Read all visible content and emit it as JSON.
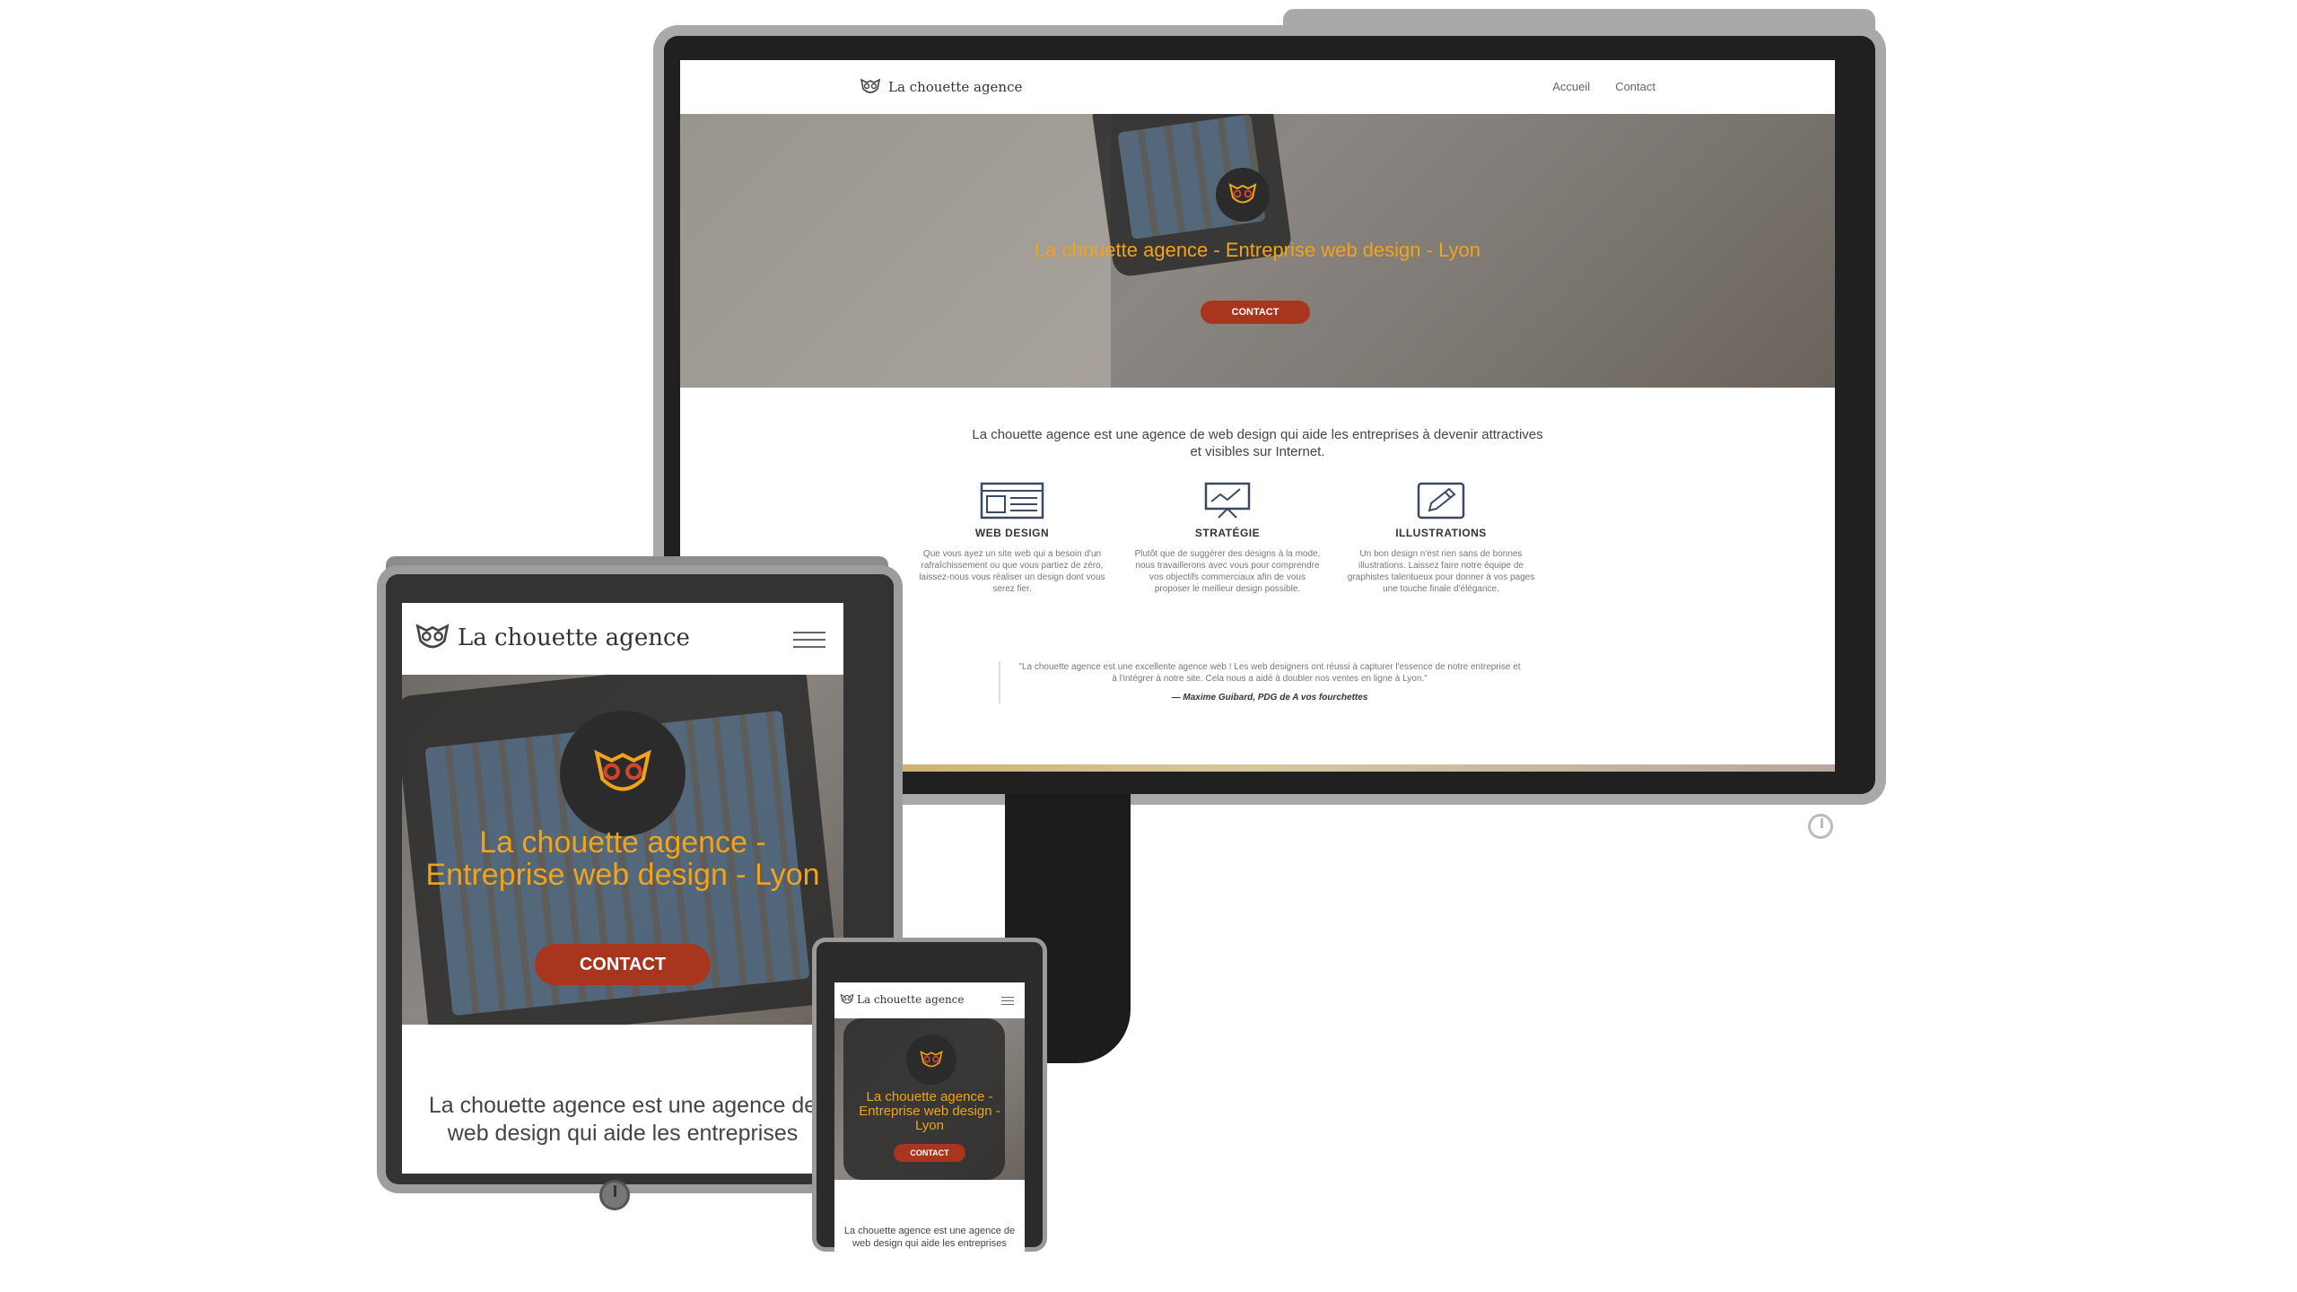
{
  "site": {
    "brand": "La chouette agence",
    "nav_links": [
      "Accueil",
      "Contact"
    ],
    "hero_title": "La chouette agence - Entreprise web design - Lyon",
    "cta_label": "CONTACT",
    "intro": "La chouette agence est une agence de web design qui aide les entreprises à devenir attractives et visibles sur Internet.",
    "intro_short": "La chouette agence est une agence de web design qui aide les entreprises",
    "services": [
      {
        "icon": "web-design-icon",
        "title": "WEB DESIGN",
        "text": "Que vous ayez un site web qui a besoin d'un rafraîchissement ou que vous partiez de zéro, laissez-nous vous réaliser un design dont vous serez fier."
      },
      {
        "icon": "strategy-chart-icon",
        "title": "STRATÉGIE",
        "text": "Plutôt que de suggérer des designs à la mode, nous travaillerons avec vous pour comprendre vos objectifs commerciaux afin de vous proposer le meilleur design possible."
      },
      {
        "icon": "pencil-icon",
        "title": "ILLUSTRATIONS",
        "text": "Un bon design n'est rien sans de bonnes illustrations. Laissez faire notre équipe de graphistes talentueux pour donner à vos pages une touche finale d'élégance."
      }
    ],
    "testimonial": {
      "quote": "\"La chouette agence est une excellente agence web ! Les web designers ont réussi à capturer l'essence de notre entreprise et à l'intégrer à notre site. Cela nous a aidé à doubler nos ventes en ligne à Lyon.\"",
      "author": "— Maxime Guibard, PDG de A vos fourchettes"
    }
  },
  "colors": {
    "accent_orange": "#f2a31a",
    "cta_red": "#a8361f",
    "device_dark": "#202020",
    "device_gray": "#a9a9a9"
  }
}
